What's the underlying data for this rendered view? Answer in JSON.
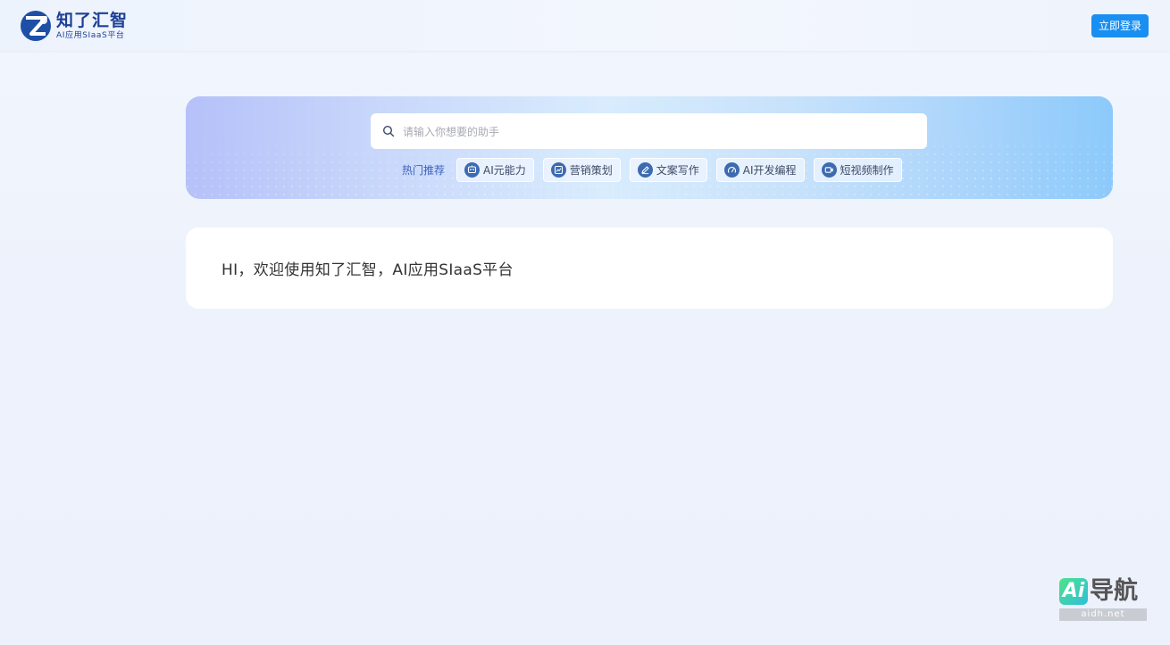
{
  "header": {
    "logo_title": "知了汇智",
    "logo_subtitle": "AI应用SIaaS平台",
    "login_label": "立即登录"
  },
  "search": {
    "placeholder": "请输入你想要的助手",
    "hot_label": "热门推荐",
    "tags": [
      {
        "label": "AI元能力",
        "icon": "robot-icon"
      },
      {
        "label": "营销策划",
        "icon": "chart-icon"
      },
      {
        "label": "文案写作",
        "icon": "pen-icon"
      },
      {
        "label": "AI开发编程",
        "icon": "code-icon"
      },
      {
        "label": "短视频制作",
        "icon": "video-icon"
      }
    ]
  },
  "welcome": {
    "text": "HI，欢迎使用知了汇智，AI应用SIaaS平台"
  },
  "watermark": {
    "badge": "Ai",
    "name": "导航",
    "site": "aidh.net"
  },
  "colors": {
    "brand": "#1d3f95",
    "primary_button": "#1a8ff2",
    "tag_icon": "#3c6bb0"
  }
}
